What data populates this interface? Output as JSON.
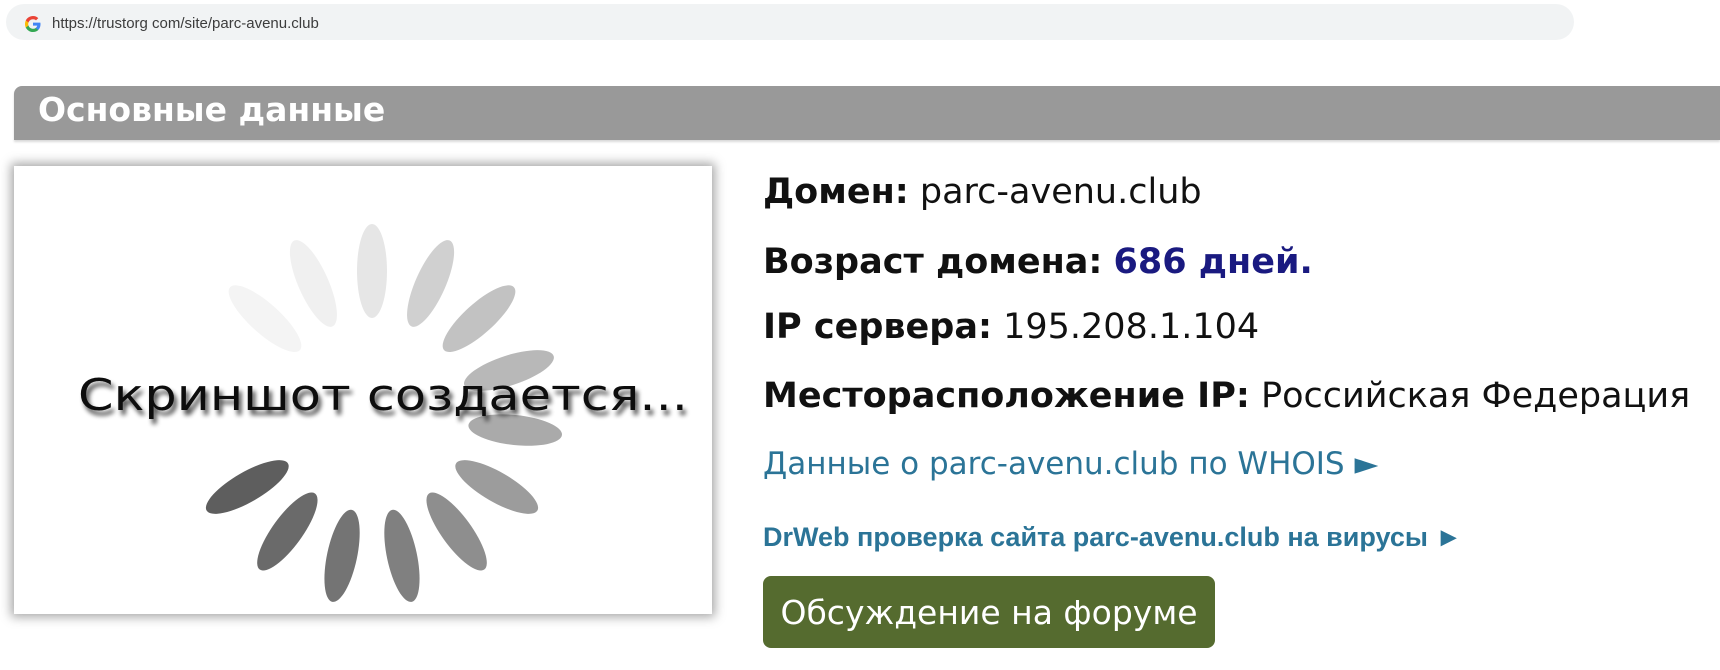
{
  "browser": {
    "url": "https://trustorg com/site/parc-avenu.club"
  },
  "section": {
    "title": "Основные данные"
  },
  "screenshot": {
    "caption": "Скриншот создается..."
  },
  "info": {
    "domain_label": "Домен:",
    "domain_value": "parc-avenu.club",
    "age_label": "Возраст домена:",
    "age_value": "686 дней.",
    "ip_label": "IP сервера:",
    "ip_value": "195.208.1.104",
    "location_label": "Месторасположение IP:",
    "location_value": "Российская Федерация"
  },
  "links": {
    "whois": "Данные о parc-avenu.club по WHOIS ►",
    "drweb": "DrWeb проверка сайта parc-avenu.club на вирусы ►"
  },
  "forum_button": "Обсуждение на форуме",
  "colors": {
    "header_bg": "#999999",
    "link": "#2b7497",
    "age_value": "#1a1a80",
    "button_bg": "#556b2f"
  },
  "icons": {
    "browser_site_icon": "google-g-icon",
    "loading_spinner": "loading-spinner-icon"
  }
}
